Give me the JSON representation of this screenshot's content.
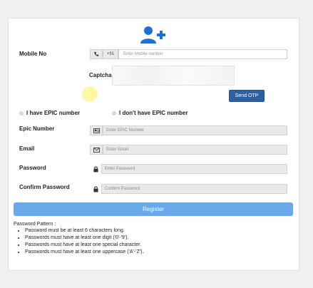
{
  "form": {
    "mobile_label": "Mobile No",
    "country_code": "+91",
    "mobile_placeholder": "Enter Mobile number",
    "captcha_label": "Captcha",
    "send_otp_label": "Send OTP",
    "epic_yes_label": "I have EPIC number",
    "epic_no_label": "I don't have EPIC number",
    "epic_label": "Epic Number",
    "epic_placeholder": "Enter EPIC Number",
    "email_label": "Email",
    "email_placeholder": "Enter Email",
    "password_label": "Password",
    "password_placeholder": "Enter Password",
    "confirm_label": "Confirm Password",
    "confirm_placeholder": "Confirm Password",
    "register_label": "Register"
  },
  "pattern": {
    "title": "Password Pattern :",
    "rules": [
      "Password must be at least 6 characters long.",
      "Passwords must have at least one digit ('0'-'9').",
      "Passwords must have at least one special character.",
      "Passwords must have at least one uppercase ('A'-'Z')."
    ]
  },
  "colors": {
    "brand_blue": "#2e5f9e",
    "register_blue": "#6ba8ea",
    "logo_blue": "#1f6fcf"
  },
  "icons": [
    "add-user-icon",
    "phone-icon",
    "id-card-icon",
    "mail-icon",
    "lock-icon"
  ]
}
